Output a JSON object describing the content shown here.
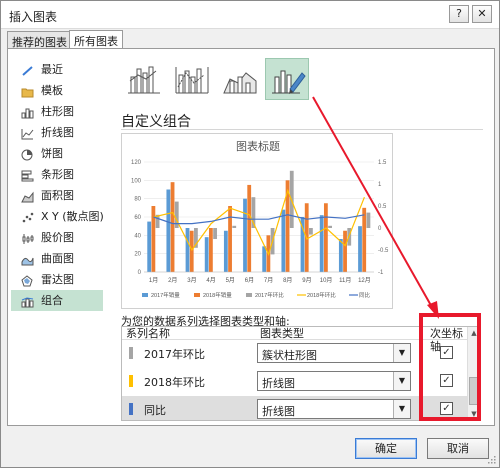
{
  "window": {
    "title": "插入图表",
    "help_label": "?",
    "close_label": "✕"
  },
  "tabs": [
    {
      "label": "推荐的图表"
    },
    {
      "label": "所有图表"
    }
  ],
  "sidebar": {
    "items": [
      {
        "label": "最近",
        "icon": "recent-icon"
      },
      {
        "label": "模板",
        "icon": "template-folder-icon"
      },
      {
        "label": "柱形图",
        "icon": "column-chart-icon"
      },
      {
        "label": "折线图",
        "icon": "line-chart-icon"
      },
      {
        "label": "饼图",
        "icon": "pie-chart-icon"
      },
      {
        "label": "条形图",
        "icon": "bar-chart-icon"
      },
      {
        "label": "面积图",
        "icon": "area-chart-icon"
      },
      {
        "label": "X Y (散点图)",
        "icon": "scatter-chart-icon"
      },
      {
        "label": "股价图",
        "icon": "stock-chart-icon"
      },
      {
        "label": "曲面图",
        "icon": "surface-chart-icon"
      },
      {
        "label": "雷达图",
        "icon": "radar-chart-icon"
      },
      {
        "label": "组合",
        "icon": "combo-chart-icon"
      }
    ],
    "selected": "组合"
  },
  "main": {
    "heading": "自定义组合",
    "series_label": "为您的数据系列选择图表类型和轴:"
  },
  "series_table": {
    "headers": {
      "name": "系列名称",
      "type": "图表类型",
      "axis": "次坐标轴"
    },
    "rows": [
      {
        "name": "2017年环比",
        "color": "#a5a5a5",
        "type": "簇状柱形图",
        "secondary": true
      },
      {
        "name": "2018年环比",
        "color": "#ffc000",
        "type": "折线图",
        "secondary": true
      },
      {
        "name": "同比",
        "color": "#4472c4",
        "type": "折线图",
        "secondary": true
      }
    ]
  },
  "buttons": {
    "ok": "确定",
    "cancel": "取消"
  },
  "check_mark": "✓",
  "chart_data": {
    "type": "bar",
    "title": "图表标题",
    "categories": [
      "1月",
      "2月",
      "3月",
      "4月",
      "5月",
      "6月",
      "7月",
      "8月",
      "9月",
      "10月",
      "11月",
      "12月"
    ],
    "ylim": [
      0,
      120
    ],
    "y_ticks": [
      "0",
      "20",
      "40",
      "60",
      "80",
      "100",
      "120"
    ],
    "y2lim": [
      -1,
      1.5
    ],
    "y2_ticks": [
      "-1",
      "-0.5",
      "0",
      "0.5",
      "1",
      "1.5"
    ],
    "series": [
      {
        "name": "2017年销量",
        "kind": "bar",
        "axis": "primary",
        "color": "#5b9bd5",
        "values": [
          55,
          90,
          48,
          38,
          45,
          80,
          28,
          68,
          60,
          62,
          36,
          50
        ]
      },
      {
        "name": "2018年销量",
        "kind": "bar",
        "axis": "primary",
        "color": "#ed7d31",
        "values": [
          72,
          98,
          45,
          48,
          72,
          95,
          40,
          100,
          75,
          75,
          45,
          70
        ]
      },
      {
        "name": "2017年环比",
        "kind": "bar",
        "axis": "secondary",
        "color": "#a5a5a5",
        "values": [
          0.3,
          0.6,
          -0.45,
          -0.25,
          0.05,
          0.7,
          -0.6,
          1.3,
          -0.15,
          0.05,
          -0.4,
          0.35
        ]
      },
      {
        "name": "2018年环比",
        "kind": "line",
        "axis": "secondary",
        "color": "#ffc000",
        "values": [
          0.25,
          0.35,
          -0.5,
          0.1,
          0.45,
          0.3,
          -0.6,
          0.85,
          -0.25,
          0.0,
          -0.4,
          0.7
        ]
      },
      {
        "name": "同比",
        "kind": "line",
        "axis": "secondary",
        "color": "#4472c4",
        "values": [
          0.25,
          0.1,
          0.1,
          0.15,
          0.25,
          0.2,
          0.2,
          0.3,
          0.2,
          0.25,
          0.22,
          0.3
        ]
      }
    ],
    "legend_position": "bottom",
    "grid": true
  }
}
